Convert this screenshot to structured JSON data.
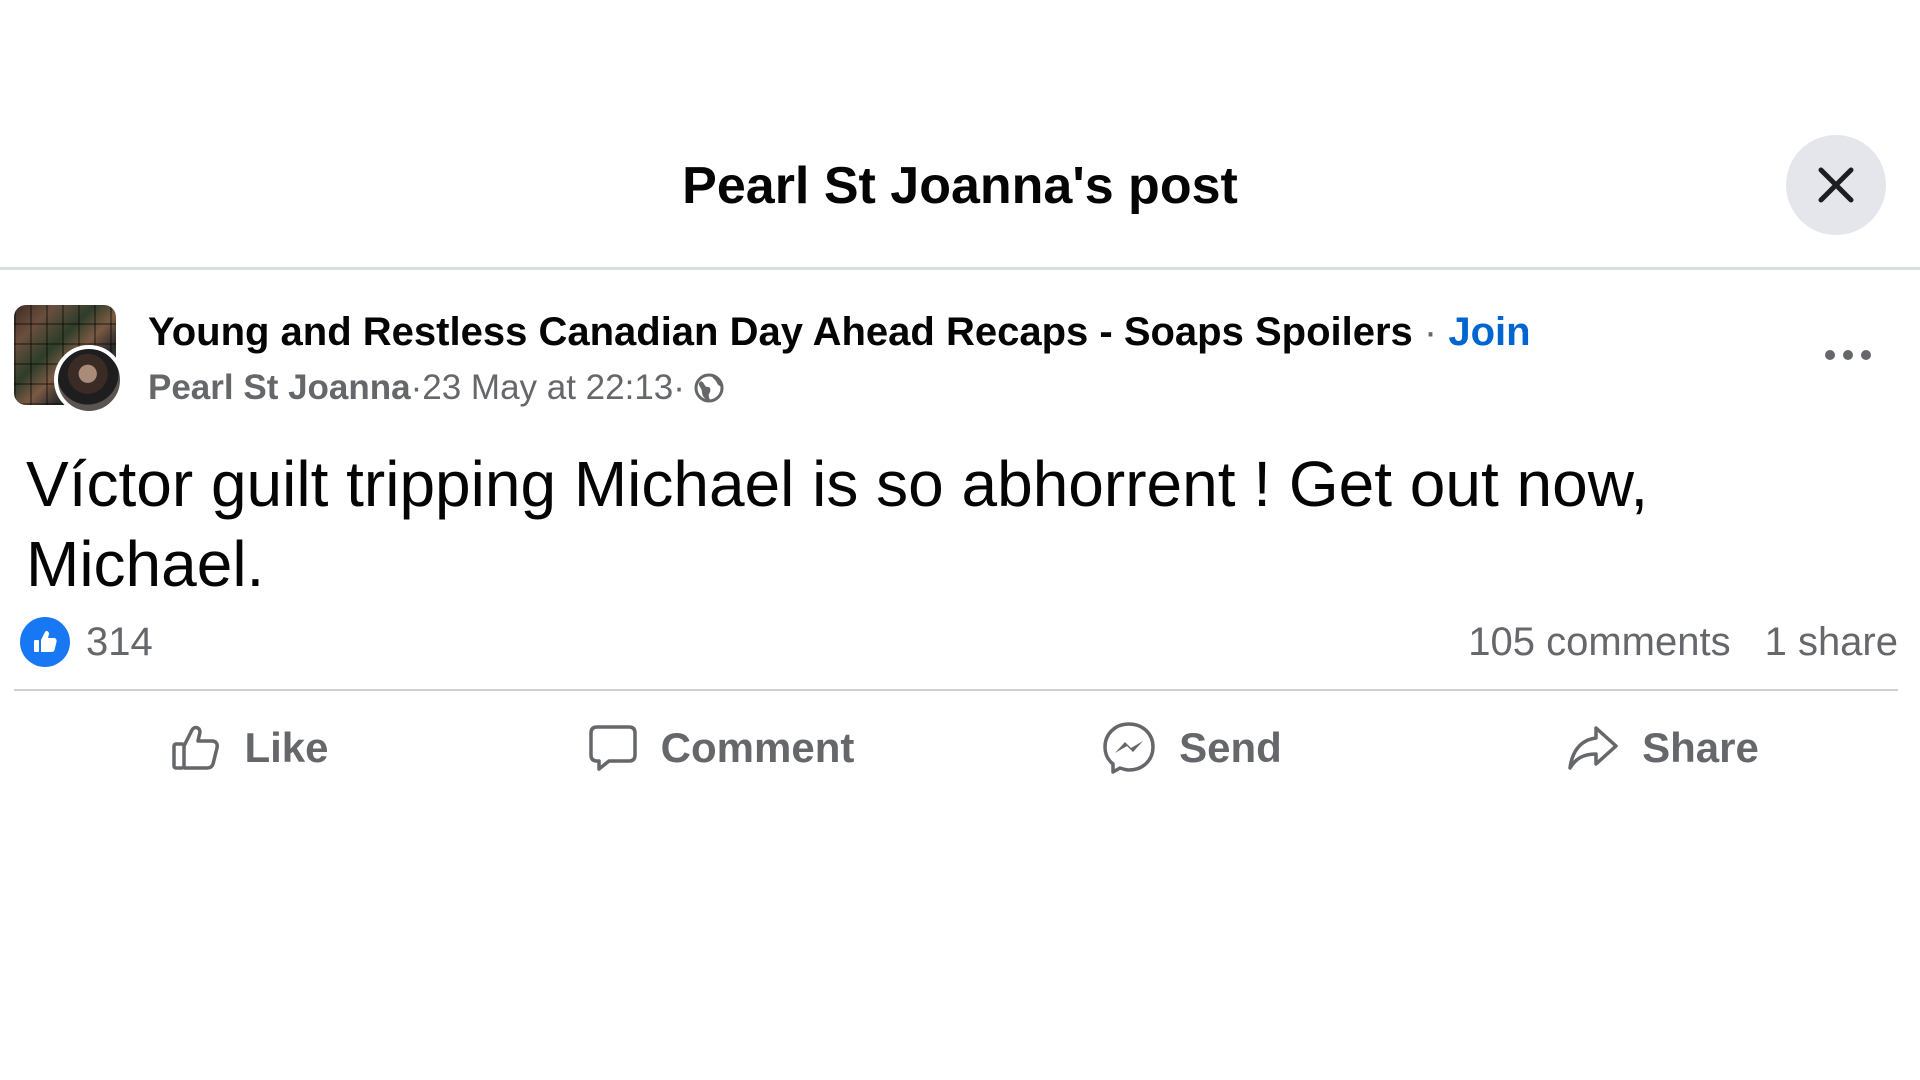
{
  "header": {
    "title": "Pearl St Joanna's post",
    "close_icon": "close-icon"
  },
  "post": {
    "group_name": "Young and Restless Canadian Day Ahead Recaps - Soaps Spoilers",
    "separator": " · ",
    "join_label": "Join",
    "author": "Pearl St Joanna",
    "date": "23 May at 22:13",
    "privacy_icon": "globe-icon",
    "more_icon": "more-horizontal-icon",
    "text": "Víctor guilt tripping Michael is so abhorrent ! Get out now, Michael.",
    "reactions_count": "314",
    "comments": "105 comments",
    "shares": "1 share"
  },
  "actions": {
    "like": "Like",
    "comment": "Comment",
    "send": "Send",
    "share": "Share"
  },
  "colors": {
    "link_blue": "#0064d1",
    "like_blue": "#1877f2",
    "secondary_text": "#65676b",
    "divider": "#ced0d4",
    "close_bg": "#e4e6eb"
  }
}
